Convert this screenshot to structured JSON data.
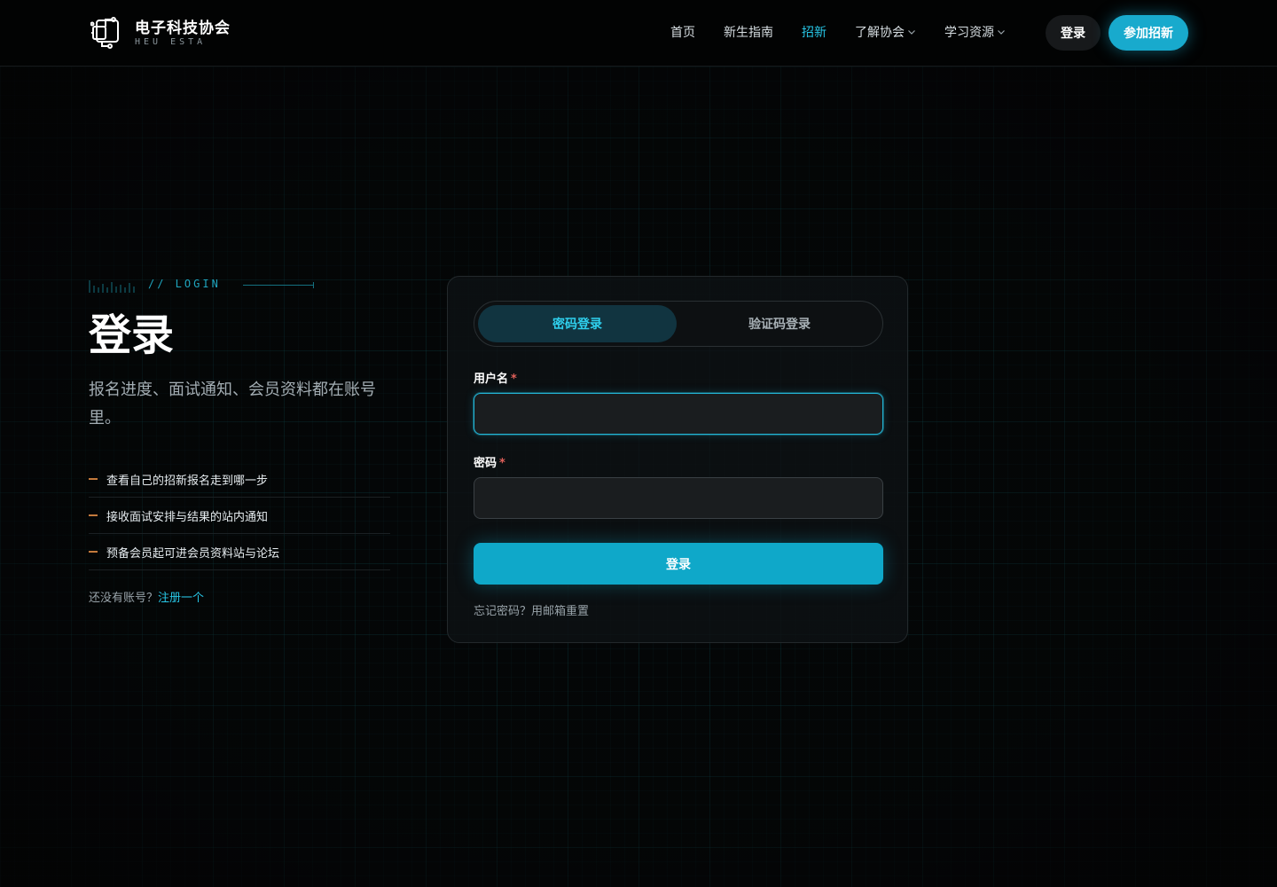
{
  "header": {
    "logo_title": "电子科技协会",
    "logo_subtitle": "HEU ESTA",
    "nav": [
      {
        "label": "首页",
        "active": false,
        "dropdown": false
      },
      {
        "label": "新生指南",
        "active": false,
        "dropdown": false
      },
      {
        "label": "招新",
        "active": true,
        "dropdown": false
      },
      {
        "label": "了解协会",
        "active": false,
        "dropdown": true
      },
      {
        "label": "学习资源",
        "active": false,
        "dropdown": true
      }
    ],
    "login_label": "登录",
    "join_label": "参加招新"
  },
  "intro": {
    "eyebrow": "// LOGIN",
    "title": "登录",
    "description": "报名进度、面试通知、会员资料都在账号里。",
    "features": [
      "查看自己的招新报名走到哪一步",
      "接收面试安排与结果的站内通知",
      "预备会员起可进会员资料站与论坛"
    ],
    "register_prompt": "还没有账号？",
    "register_link": "注册一个"
  },
  "form": {
    "tabs": [
      {
        "label": "密码登录",
        "active": true
      },
      {
        "label": "验证码登录",
        "active": false
      }
    ],
    "username_label": "用户名",
    "username_value": "",
    "password_label": "密码",
    "password_value": "",
    "required_mark": "*",
    "submit_label": "登录",
    "forgot_text": "忘记密码？用邮箱重置"
  },
  "colors": {
    "accent": "#18aacd",
    "accent_text": "#27c6e6",
    "background": "#050607",
    "required": "#e0605a",
    "feature_marker": "#c47a3c"
  },
  "icons": {
    "logo": "circuit-logo-icon",
    "dropdown": "chevron-down-icon"
  }
}
